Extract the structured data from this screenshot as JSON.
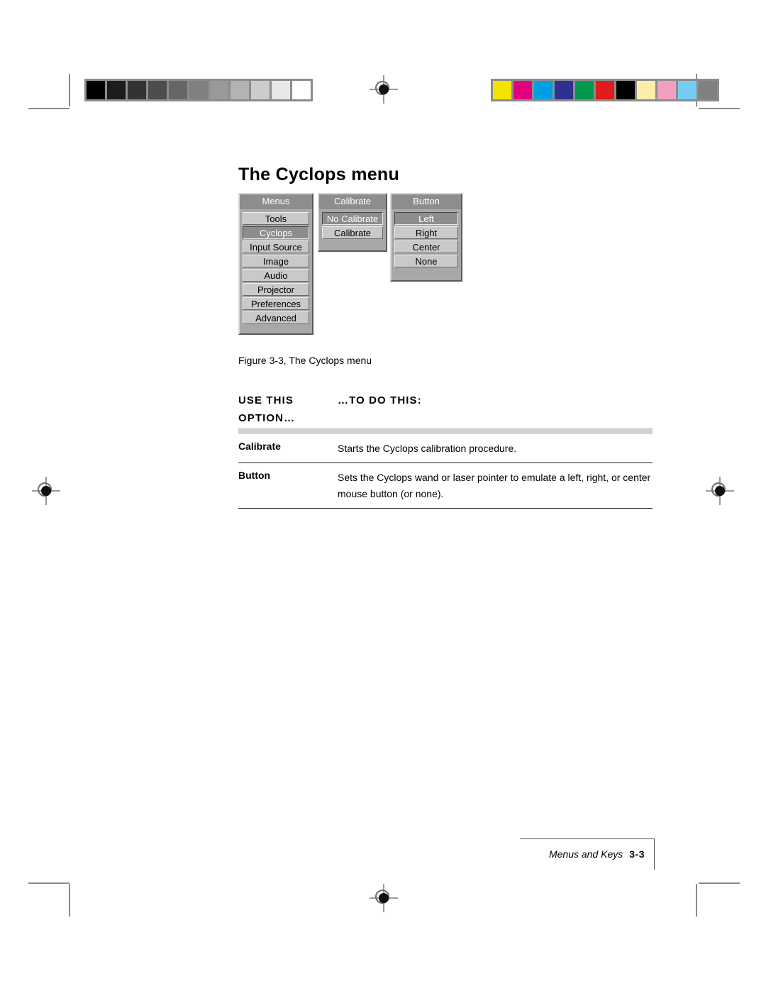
{
  "document": {
    "title": "The Cyclops menu",
    "figure_caption": "Figure 3-3, The Cyclops menu",
    "footer": {
      "section_label": "Menus and Keys",
      "page_number": "3-3"
    }
  },
  "figure": {
    "panels": [
      {
        "title": "Menus",
        "items": [
          {
            "label": "Tools",
            "selected": false
          },
          {
            "label": "Cyclops",
            "selected": true
          },
          {
            "label": "Input Source",
            "selected": false
          },
          {
            "label": "Image",
            "selected": false
          },
          {
            "label": "Audio",
            "selected": false
          },
          {
            "label": "Projector",
            "selected": false
          },
          {
            "label": "Preferences",
            "selected": false
          },
          {
            "label": "Advanced",
            "selected": false
          }
        ]
      },
      {
        "title": "Calibrate",
        "items": [
          {
            "label": "No Calibrate",
            "selected": true
          },
          {
            "label": "Calibrate",
            "selected": false
          }
        ]
      },
      {
        "title": "Button",
        "items": [
          {
            "label": "Left",
            "selected": true
          },
          {
            "label": "Right",
            "selected": false
          },
          {
            "label": "Center",
            "selected": false
          },
          {
            "label": "None",
            "selected": false
          }
        ]
      }
    ]
  },
  "option_table": {
    "header": {
      "col1_line1": "USE THIS",
      "col1_line2": "OPTION…",
      "col2": "…TO DO THIS:"
    },
    "rows": [
      {
        "term": "Calibrate",
        "description": "Starts the Cyclops calibration procedure."
      },
      {
        "term": "Button",
        "description": "Sets the Cyclops wand or laser pointer to emulate a left, right, or center mouse button (or none)."
      }
    ]
  },
  "print_marks": {
    "grayscale_wedge": [
      "#000000",
      "#1c1c1c",
      "#333333",
      "#4d4d4d",
      "#666666",
      "#808080",
      "#999999",
      "#b3b3b3",
      "#cccccc",
      "#e8e8e8",
      "#ffffff"
    ],
    "color_bar": [
      "#f2e300",
      "#e3007f",
      "#009fe3",
      "#2e3192",
      "#00994d",
      "#e01b1b",
      "#000000",
      "#fbeeaa",
      "#f2a0c0",
      "#74cdf0",
      "#808080"
    ],
    "registration_icon": "registration-target-icon"
  }
}
